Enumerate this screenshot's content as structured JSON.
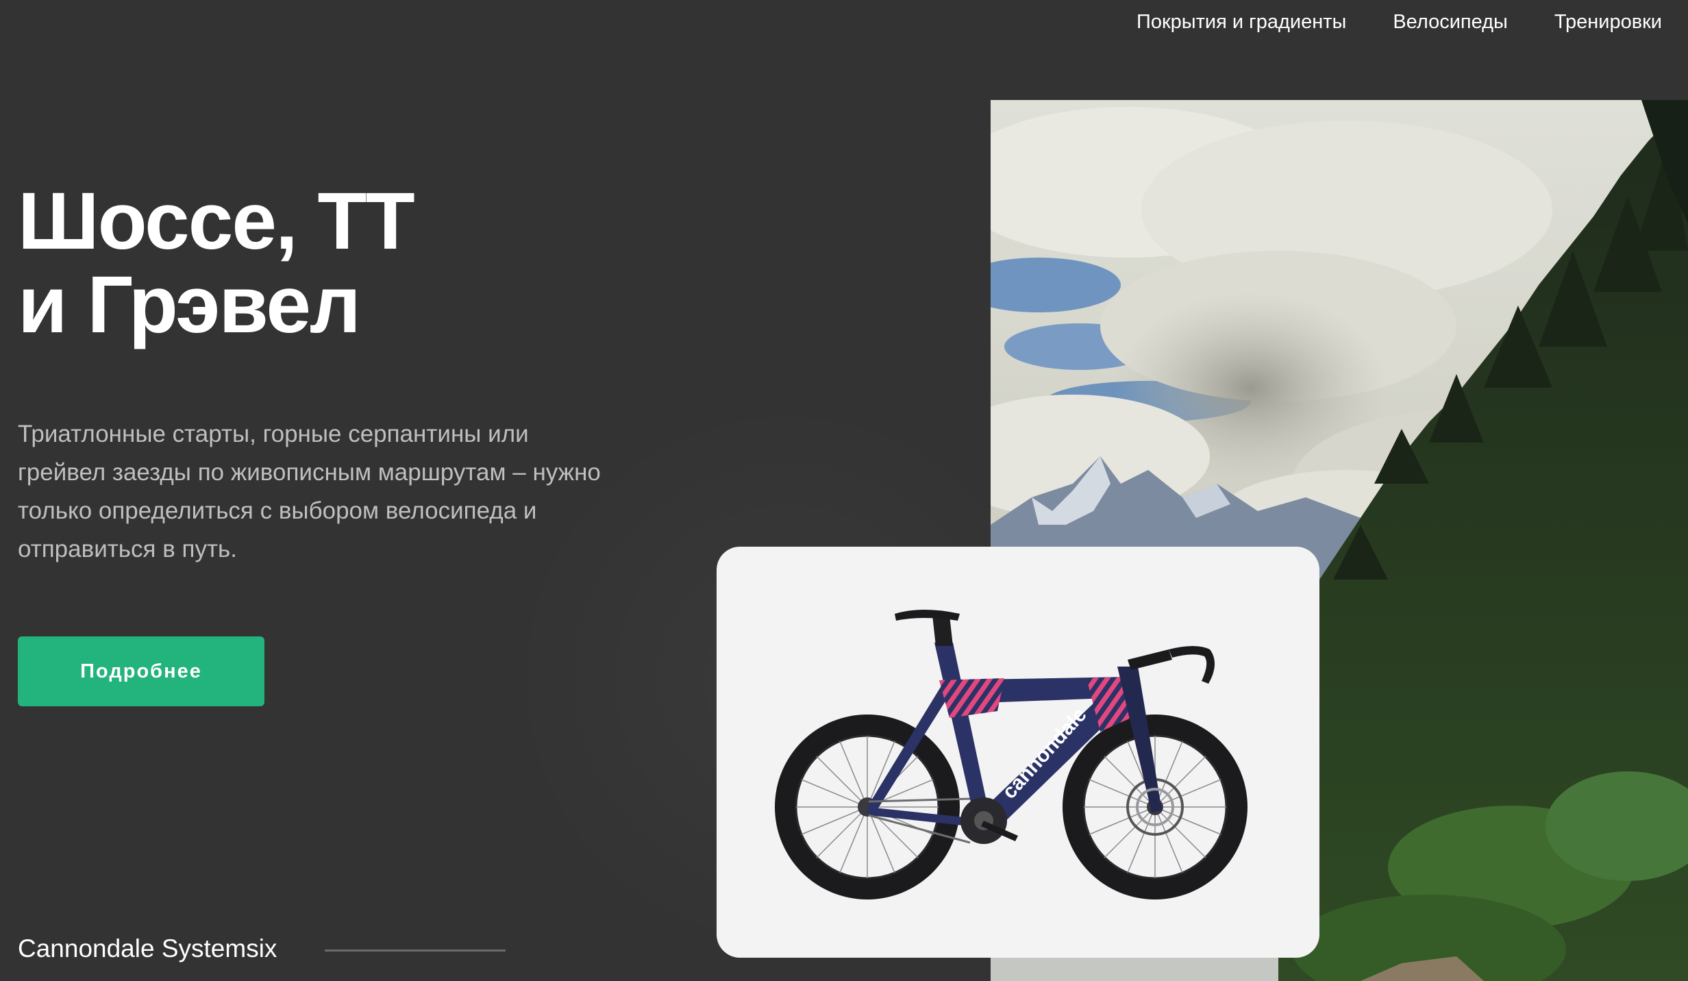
{
  "nav": {
    "items": [
      {
        "label": "Покрытия и градиенты"
      },
      {
        "label": "Велосипеды"
      },
      {
        "label": "Тренировки"
      }
    ]
  },
  "hero": {
    "title_line1": "Шоссе, ТТ",
    "title_line2": "и Грэвел",
    "description": "Триатлонные старты, горные серпантины или грейвел заезды по живописным маршрутам – нужно только определиться с выбором велосипеда и отправиться в путь.",
    "cta_label": "Подробнее"
  },
  "featured": {
    "caption": "Cannondale Systemsix",
    "brand_text": "cannondale"
  },
  "colors": {
    "background": "#333333",
    "accent": "#23b37c",
    "card": "#f3f3f3",
    "frame": "#2b3266",
    "pattern": "#e2477e"
  }
}
